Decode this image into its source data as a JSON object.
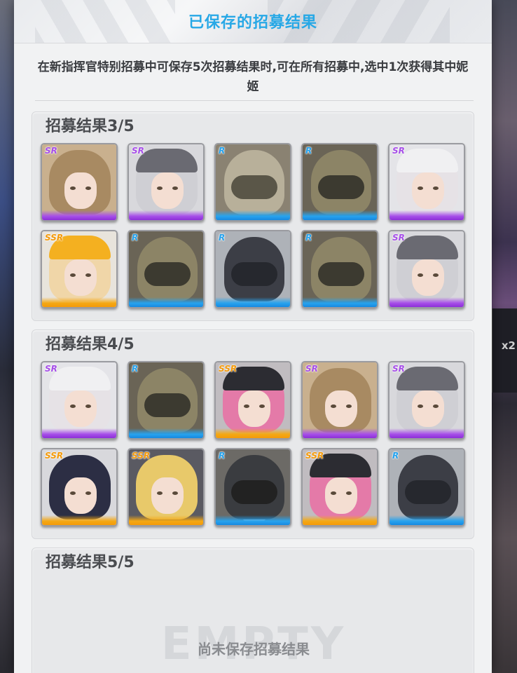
{
  "modal": {
    "title": "已保存的招募结果",
    "description": "在新指挥官特别招募中可保存5次招募结果时,可在所有招募中,选中1次获得其中妮姬"
  },
  "background": {
    "badge": "x2"
  },
  "panels": [
    {
      "title": "招募结果3/5",
      "cards": [
        {
          "rarity": "SR",
          "style": "blonde"
        },
        {
          "rarity": "SR",
          "style": "silver-cap"
        },
        {
          "rarity": "R",
          "style": "helmet-tan"
        },
        {
          "rarity": "R",
          "style": "helmet-olive"
        },
        {
          "rarity": "SR",
          "style": "silver-glasses"
        },
        {
          "rarity": "SSR",
          "style": "hardhat"
        },
        {
          "rarity": "R",
          "style": "helmet-olive"
        },
        {
          "rarity": "R",
          "style": "helmet-dark"
        },
        {
          "rarity": "R",
          "style": "helmet-olive"
        },
        {
          "rarity": "SR",
          "style": "silver-cap"
        }
      ]
    },
    {
      "title": "招募结果4/5",
      "cards": [
        {
          "rarity": "SR",
          "style": "silver-glasses"
        },
        {
          "rarity": "R",
          "style": "helmet-olive"
        },
        {
          "rarity": "SSR",
          "style": "pink-headset"
        },
        {
          "rarity": "SR",
          "style": "blonde"
        },
        {
          "rarity": "SR",
          "style": "silver-cap"
        },
        {
          "rarity": "SSR",
          "style": "dark-hair"
        },
        {
          "rarity": "SSR",
          "style": "blonde-bright"
        },
        {
          "rarity": "R",
          "style": "helmet-mask"
        },
        {
          "rarity": "SSR",
          "style": "pink-headset"
        },
        {
          "rarity": "R",
          "style": "helmet-dark"
        }
      ]
    },
    {
      "title": "招募结果5/5",
      "empty_text": "尚未保存招募结果",
      "empty_watermark": "EMPTY"
    }
  ]
}
